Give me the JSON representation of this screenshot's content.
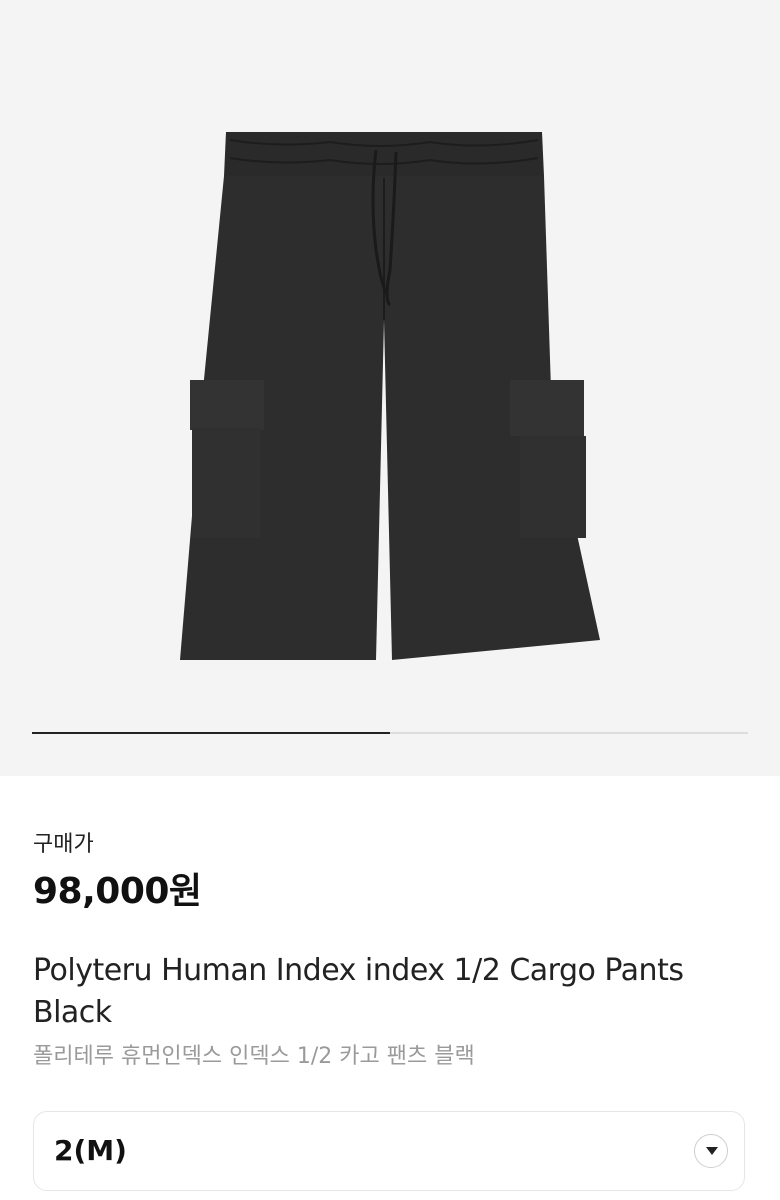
{
  "gallery": {
    "image_icon": "cargo-shorts-photo",
    "progress": 0.5
  },
  "product": {
    "price_label": "구매가",
    "price": "98,000원",
    "title_en": "Polyteru Human Index index 1/2 Cargo Pants Black",
    "title_ko": "폴리테루 휴먼인덱스 인덱스 1/2 카고 팬츠 블랙"
  },
  "size_select": {
    "value": "2(M)",
    "icon": "chevron-down-icon"
  },
  "colors": {
    "product": "#2b2b2b",
    "background": "#f4f4f4",
    "accent": "#222222"
  }
}
